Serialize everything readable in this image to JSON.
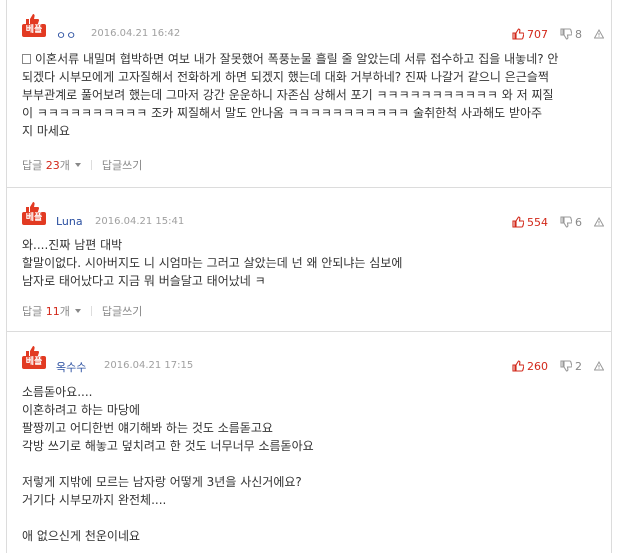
{
  "badge_label": "베플",
  "comments": [
    {
      "author": "ㅇㅇ",
      "date": "2016.04.21 16:42",
      "up": "707",
      "down": "8",
      "body": "이혼서류 내밀며 협박하면 여보 내가 잘못했어 폭풍눈물 흘릴 줄 알았는데 서류 접수하고 집을 내놓네? 안\n되겠다 시부모에게 고자질해서 전화하게 하면 되겠지 했는데 대화 거부하네? 진짜 나갈거 같으니 은근슬쩍\n부부관계로 풀어보려 했는데 그마저 강간 운운하니 자존심 상해서 포기 ㅋㅋㅋㅋㅋㅋㅋㅋㅋㅋㅋ 와 저 찌질\n이 ㅋㅋㅋㅋㅋㅋㅋㅋㅋㅋ 조카 찌질해서 말도 안나옴 ㅋㅋㅋㅋㅋㅋㅋㅋㅋㅋㅋ 술취한척 사과해도 받아주\n지 마세요",
      "reply_label": "답글",
      "reply_count": "23",
      "reply_unit": "개",
      "write_reply": "답글쓰기"
    },
    {
      "author": "Luna",
      "date": "2016.04.21 15:41",
      "up": "554",
      "down": "6",
      "body": "와....진짜 남편 대박\n할말이없다. 시아버지도 니 시엄마는 그러고 살았는데 넌 왜 안되냐는 심보에\n남자로 태어났다고 지금 뭐 버슬달고 태어났네 ㅋ",
      "reply_label": "답글",
      "reply_count": "11",
      "reply_unit": "개",
      "write_reply": "답글쓰기"
    },
    {
      "author": "옥수수",
      "date": "2016.04.21 17:15",
      "up": "260",
      "down": "2",
      "body": "소름돋아요....\n이혼하려고 하는 마당에\n팔짱끼고 어디한번 얘기해봐 하는 것도 소름돋고요\n각방 쓰기로 해놓고 덮치려고 한 것도 너무너무 소름돋아요\n\n저렇게 지밖에 모르는 남자랑 어떻게 3년을 사신거에요?\n거기다 시부모까지 완전체....\n\n애 없으신게 천운이네요"
    }
  ]
}
